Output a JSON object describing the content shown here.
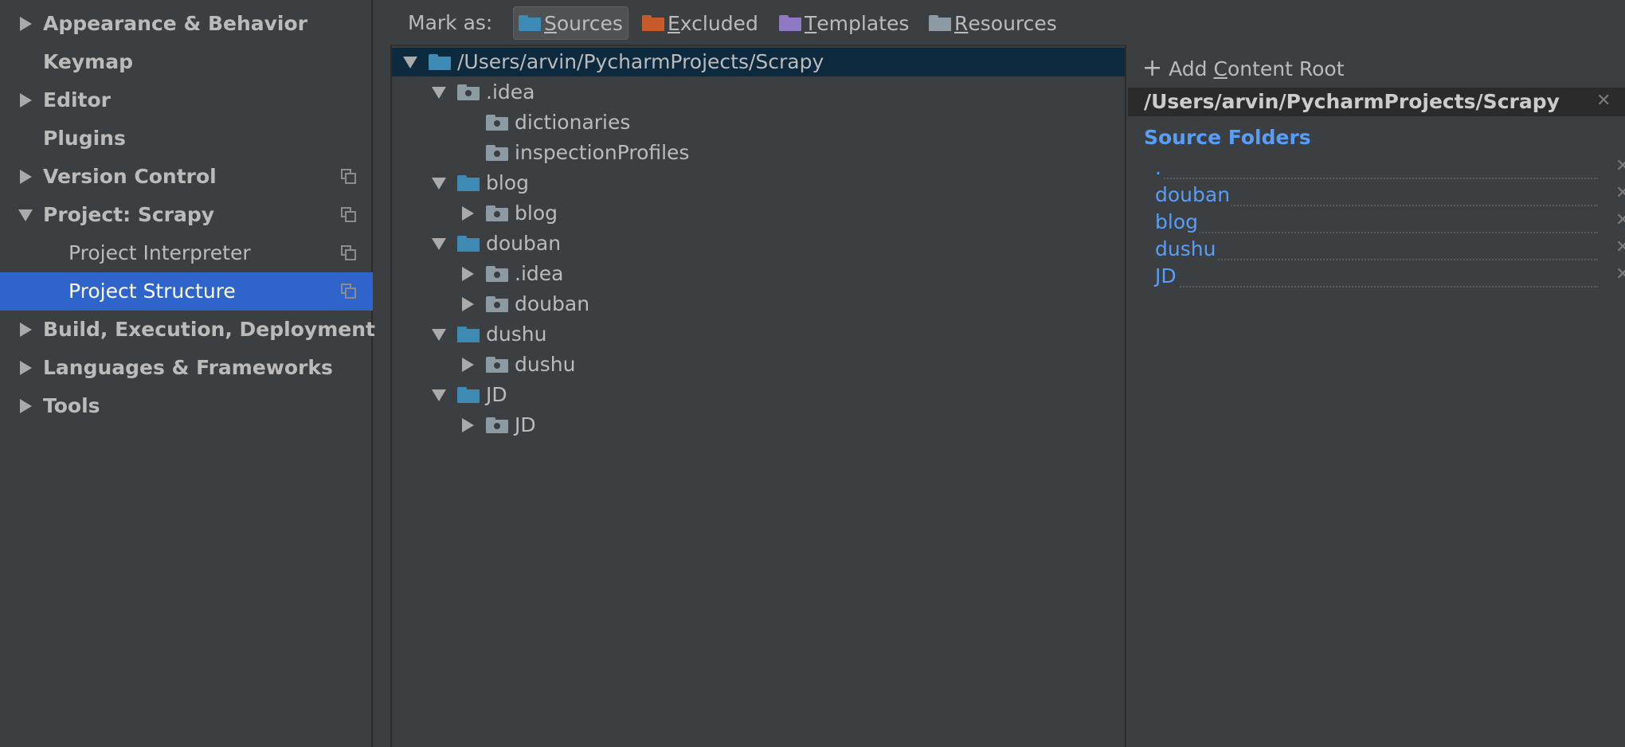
{
  "sidebar": {
    "items": [
      {
        "label": "Appearance & Behavior",
        "arrow": "right",
        "bold": true,
        "copy": false
      },
      {
        "label": "Keymap",
        "arrow": "none",
        "bold": true,
        "copy": false
      },
      {
        "label": "Editor",
        "arrow": "right",
        "bold": true,
        "copy": false
      },
      {
        "label": "Plugins",
        "arrow": "none",
        "bold": true,
        "copy": false
      },
      {
        "label": "Version Control",
        "arrow": "right",
        "bold": true,
        "copy": true
      },
      {
        "label": "Project: Scrapy",
        "arrow": "down",
        "bold": true,
        "copy": true
      },
      {
        "label": "Project Interpreter",
        "arrow": "none",
        "bold": false,
        "copy": true
      },
      {
        "label": "Project Structure",
        "arrow": "none",
        "bold": false,
        "copy": true,
        "selected": true
      },
      {
        "label": "Build, Execution, Deployment",
        "arrow": "right",
        "bold": true,
        "copy": false
      },
      {
        "label": "Languages & Frameworks",
        "arrow": "right",
        "bold": true,
        "copy": false
      },
      {
        "label": "Tools",
        "arrow": "right",
        "bold": true,
        "copy": false
      }
    ]
  },
  "toolbar": {
    "mark_as_label": "Mark as:",
    "buttons": [
      {
        "label_first": "S",
        "label_rest": "ources",
        "color": "#3d8bb5",
        "active": true
      },
      {
        "label_first": "E",
        "label_rest": "xcluded",
        "color": "#c75a2b",
        "active": false
      },
      {
        "label_first": "T",
        "label_rest": "emplates",
        "color": "#8e79c2",
        "active": false
      },
      {
        "label_first": "R",
        "label_rest": "esources",
        "color": "#8c9aa3",
        "active": false
      }
    ]
  },
  "tree": {
    "rows": [
      {
        "label": "/Users/arvin/PycharmProjects/Scrapy",
        "depth": 0,
        "arrow": "down",
        "folder": "source",
        "selected": true
      },
      {
        "label": ".idea",
        "depth": 1,
        "arrow": "down",
        "folder": "gray"
      },
      {
        "label": "dictionaries",
        "depth": 2,
        "arrow": "none",
        "folder": "gray"
      },
      {
        "label": "inspectionProfiles",
        "depth": 2,
        "arrow": "none",
        "folder": "gray"
      },
      {
        "label": "blog",
        "depth": 1,
        "arrow": "down",
        "folder": "source"
      },
      {
        "label": "blog",
        "depth": 2,
        "arrow": "right",
        "folder": "gray"
      },
      {
        "label": "douban",
        "depth": 1,
        "arrow": "down",
        "folder": "source"
      },
      {
        "label": ".idea",
        "depth": 2,
        "arrow": "right",
        "folder": "gray"
      },
      {
        "label": "douban",
        "depth": 2,
        "arrow": "right",
        "folder": "gray"
      },
      {
        "label": "dushu",
        "depth": 1,
        "arrow": "down",
        "folder": "source"
      },
      {
        "label": "dushu",
        "depth": 2,
        "arrow": "right",
        "folder": "gray"
      },
      {
        "label": "JD",
        "depth": 1,
        "arrow": "down",
        "folder": "source"
      },
      {
        "label": "JD",
        "depth": 2,
        "arrow": "right",
        "folder": "gray"
      }
    ]
  },
  "roots": {
    "add_label_prefix": "Add ",
    "add_label_u": "C",
    "add_label_rest": "ontent Root",
    "root_path": "/Users/arvin/PycharmProjects/Scrapy",
    "source_folders_title": "Source Folders",
    "source_folders": [
      ".",
      "douban",
      "blog",
      "dushu",
      "JD"
    ],
    "close_glyph": "✕"
  },
  "colors": {
    "source_folder": "#3d8bb5",
    "gray_folder": "#8c9aa3",
    "selection": "#2f65ca",
    "tree_selection": "#0d293e",
    "link_blue": "#589df6"
  }
}
